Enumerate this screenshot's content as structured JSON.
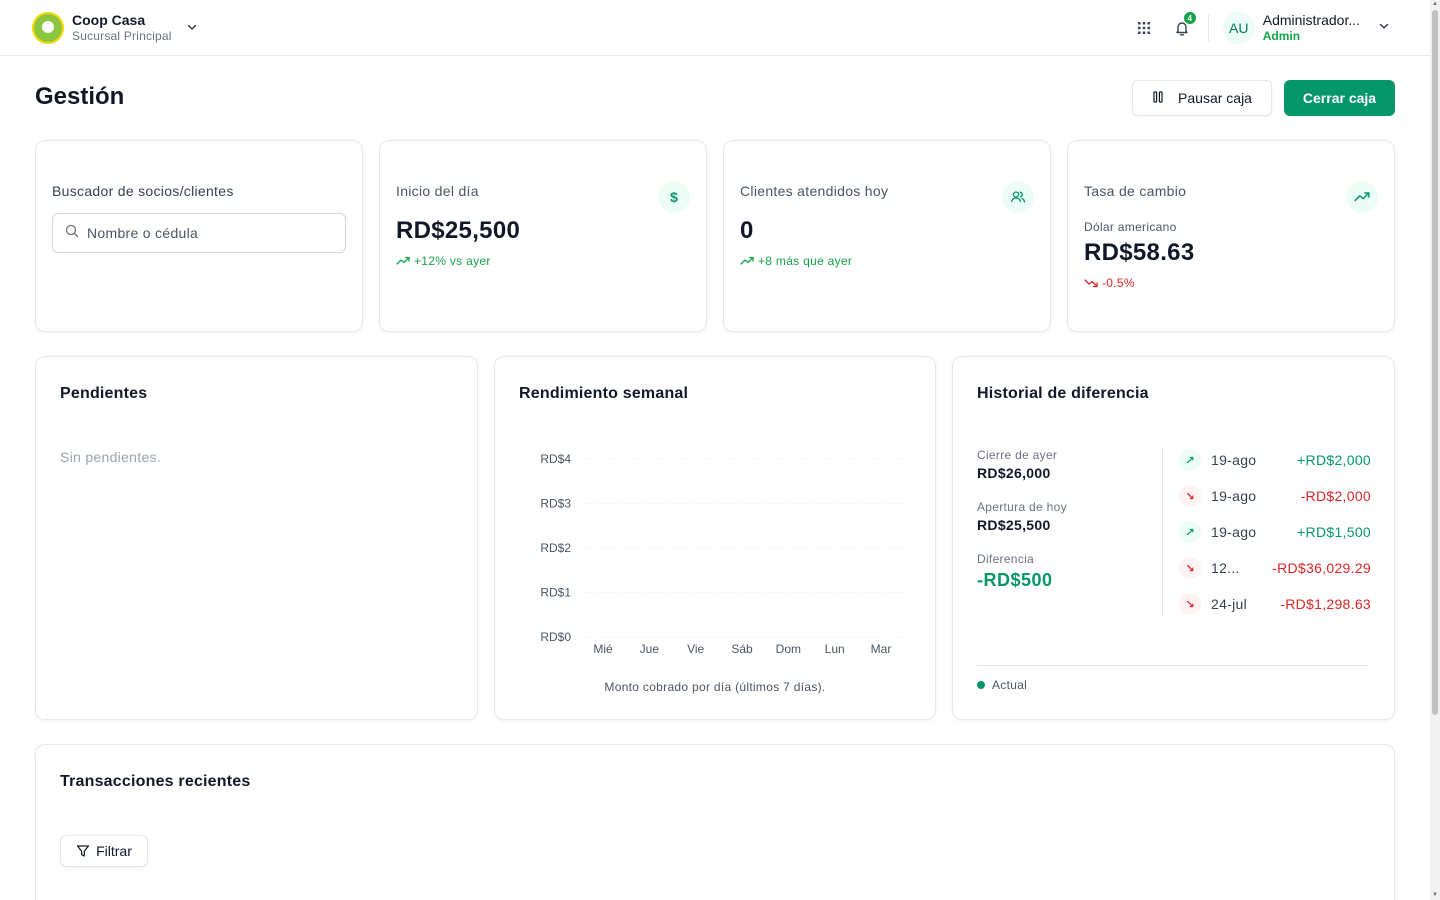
{
  "header": {
    "brand_name": "Coop Casa",
    "branch": "Sucursal Principal",
    "notifications_count": "4",
    "user_initials": "AU",
    "user_name": "Administrador...",
    "user_role": "Admin"
  },
  "page": {
    "title": "Gestión",
    "pause_label": "Pausar caja",
    "close_label": "Cerrar caja"
  },
  "search_card": {
    "title": "Buscador de socios/clientes",
    "placeholder": "Nombre o cédula"
  },
  "stats": {
    "inicio": {
      "label": "Inicio del día",
      "value": "RD$25,500",
      "trend": "+12% vs ayer",
      "icon": "dollar-icon"
    },
    "clientes": {
      "label": "Clientes atendidos hoy",
      "value": "0",
      "trend": "+8 más que ayer",
      "icon": "users-icon"
    },
    "tasa": {
      "label": "Tasa de cambio",
      "currency": "Dólar americano",
      "value": "RD$58.63",
      "trend": "-0.5%",
      "icon": "trending-up-icon"
    }
  },
  "pendientes": {
    "title": "Pendientes",
    "empty_text": "Sin pendientes."
  },
  "rendimiento": {
    "title": "Rendimiento semanal",
    "caption": "Monto cobrado por día (últimos 7 días)."
  },
  "chart_data": {
    "type": "line",
    "title": "Rendimiento semanal",
    "categories": [
      "Mié",
      "Jue",
      "Vie",
      "Sáb",
      "Dom",
      "Lun",
      "Mar"
    ],
    "series": [
      {
        "values": [
          0,
          0,
          0,
          0,
          0,
          0,
          0
        ]
      }
    ],
    "y_tick_labels": [
      "RD$0",
      "RD$1",
      "RD$2",
      "RD$3",
      "RD$4"
    ],
    "y_ticks": [
      0,
      1,
      2,
      3,
      4
    ],
    "ylim": [
      0,
      4
    ],
    "grid": true,
    "xlabel": "",
    "ylabel": ""
  },
  "historial": {
    "title": "Historial de diferencia",
    "cierre_label": "Cierre de ayer",
    "cierre_value": "RD$26,000",
    "apertura_label": "Apertura de hoy",
    "apertura_value": "RD$25,500",
    "diferencia_label": "Diferencia",
    "diferencia_value": "-RD$500",
    "legend": "Actual",
    "rows": [
      {
        "direction": "up",
        "date": "19-ago",
        "amount": "+RD$2,000"
      },
      {
        "direction": "down",
        "date": "19-ago",
        "amount": "-RD$2,000"
      },
      {
        "direction": "up",
        "date": "19-ago",
        "amount": "+RD$1,500"
      },
      {
        "direction": "down",
        "date": "12...",
        "amount": "-RD$36,029.29"
      },
      {
        "direction": "down",
        "date": "24-jul",
        "amount": "-RD$1,298.63"
      }
    ]
  },
  "transacciones": {
    "title": "Transacciones recientes",
    "filter_label": "Filtrar"
  },
  "colors": {
    "primary": "#059669",
    "positive": "#16a34a",
    "negative": "#dc2626"
  }
}
